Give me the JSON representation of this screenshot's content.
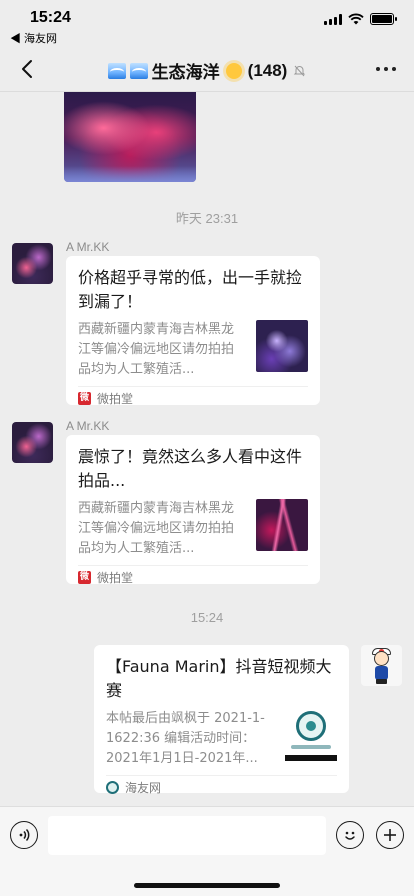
{
  "status_bar": {
    "time": "15:24",
    "back_app": "◀ 海友网"
  },
  "nav": {
    "title": "生态海洋",
    "member_count": "(148)",
    "mute_icon": "bell-slash-icon"
  },
  "timestamps": [
    "昨天 23:31",
    "15:24"
  ],
  "messages": [
    {
      "sender": "A  Mr.KK",
      "title": "价格超乎寻常的低，出一手就捡到漏了！",
      "desc": "西藏新疆内蒙青海吉林黑龙江等偏冷偏远地区请勿拍拍品均为人工繁殖活...",
      "source": "微拍堂",
      "source_icon_text": "微"
    },
    {
      "sender": "A  Mr.KK",
      "title": "震惊了！竟然这么多人看中这件拍品...",
      "desc": "西藏新疆内蒙青海吉林黑龙江等偏冷偏远地区请勿拍拍品均为人工繁殖活...",
      "source": "微拍堂",
      "source_icon_text": "微"
    },
    {
      "title": "【Fauna Marin】抖音短视频大赛",
      "desc": "本帖最后由飒枫于 2021-1-1622:36 编辑活动时间：2021年1月1日-2021年...",
      "source": "海友网"
    }
  ],
  "input": {
    "value": ""
  },
  "colors": {
    "background": "#ededed",
    "card": "#ffffff",
    "source_red": "#d7282f",
    "muted_text": "#8d8d8d"
  }
}
